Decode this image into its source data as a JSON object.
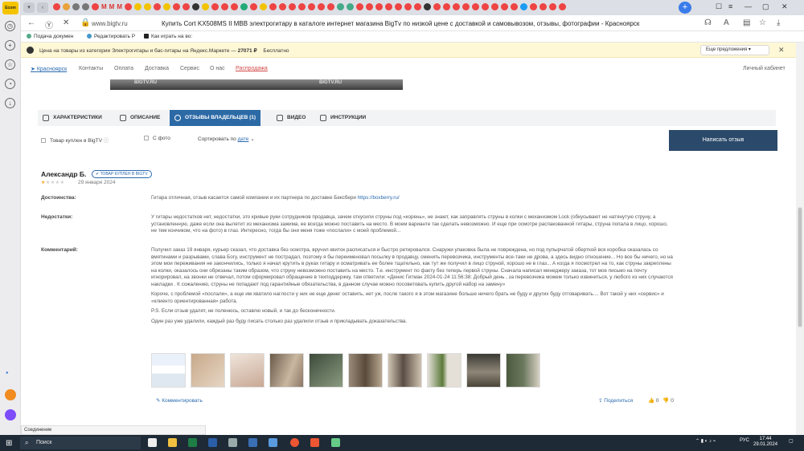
{
  "browser": {
    "sidebar_logo": "Ecom",
    "tab_title": "Купить Cort KX508MS II MBB электрогитару в каталоге интернет магазина BigTv по низкой цене с доставкой и самовывозом, отзывы, фотографии - Красноярск",
    "url": "www.bigtv.ru",
    "favicon_letters": [
      "M",
      "M",
      "M"
    ],
    "new_tab_icon": "plus-icon",
    "bookmarks": [
      "Подача докумен",
      "Редактировать Р",
      "Как играть на во:"
    ]
  },
  "infobar": {
    "text_prefix": "Цена на товары из категории Электрогитары и бас-гитары на Яндекс.Маркете —",
    "price": "27071 ₽",
    "text_suffix": "Бесплатно",
    "more_label": "Еще предложения ▾",
    "close_label": "✕"
  },
  "site_nav": {
    "city": "Красноярск",
    "items": [
      "Контакты",
      "Оплата",
      "Доставка",
      "Сервис",
      "О нас"
    ],
    "sale": "Распродажа",
    "account": "Личный кабинет",
    "banner_text": "BIGTV.RU"
  },
  "tabs": [
    {
      "label": "ХАРАКТЕРИСТИКИ",
      "icon": "info-icon"
    },
    {
      "label": "ОПИСАНИЕ",
      "icon": "document-icon"
    },
    {
      "label": "ОТЗЫВЫ ВЛАДЕЛЬЦЕВ (1)",
      "icon": "chat-icon"
    },
    {
      "label": "ВИДЕО",
      "icon": "play-icon"
    },
    {
      "label": "ИНСТРУКЦИИ",
      "icon": "book-icon"
    }
  ],
  "filters": {
    "bought": "Товар куплен в BigTV",
    "with_photo": "С фото",
    "sort_label": "Сортировать по",
    "sort_value": "дате",
    "write_review": "Написать отзыв"
  },
  "review": {
    "author": "Александр Б.",
    "badge": "ТОВАР КУПЛЕН В BIGTV",
    "rating": 1,
    "rating_max": 5,
    "date": "29 января 2024",
    "pros_label": "Достоинства:",
    "pros": "Гитара отличная, отзыв касается самой компании и их партнера по доставке Бексбери",
    "pros_link": "https://boxberry.ru/",
    "cons_label": "Недостатки:",
    "cons": "У гитары недостатков нет, недостатки, это кривые руки сотрудников продавца, зачем откусили струны под «корень», не знают, как заправлять струны в колки с механизмом Lock (обкусывают не натянутую струну, а установленную, даже если она вылетит из механизма зажима, ее всегда можно поставить на место. В моем варианте так сделать невозможно. И еще при осмотре распакованной гитары, струна попала в лицо, хорошо, не тем кончиком, что на фото) в глаз. Интересно, тогда бы они меня тоже «послали» с моей проблемой...",
    "comment_label": "Комментарий:",
    "comment_p1": "Получил заказ 19 января, курьер сказал, что доставка без осмотра, вручил квиток расписаться и быстро ретировался. Снаружи упаковка была не повреждена, но под пупырчатой оберткой вся коробка оказалась со вмятинами и разрывами, слава Богу, инструмент не пострадал, поэтому я бы переименовал посылку в продавцу, сменить перевозчика, инструменты все-таки не дрова, а здесь видно отношение... Но все бы ничего, но на этом мои переживания не закончились, только я начал крутить в руках гитару и осматривать ее более тщательно, как тут же получил в лицо струной, хорошо не в глаз... А когда я посмотрел на то, как струны закреплены на колки, оказалось они обрезаны таким образом, что струну невозможно поставить на место. Т.е. инструмент по факту без теперь первой струны. Сначала написал менеджеру заказа, тот мое письмо на почту игнорировал, на звонки не отвечал, потом сформировал обращение в техподдержку, там ответили: «Денис Гитман 2024-01-24 11:56:38: Добрый день , за перевозчика можем только извиниться, у любого из них случаются накладки . К сожалению, струны не попадают под гарантийные обязательства, в данном случае можно посоветовать купить другой набор на замену»",
    "comment_p2": "Короче, с проблемой «послали», а еще им хватило наглости у них не еще денег оставить, нет уж, после такого я в этом магазине больше ничего брать не буду и других буду отговаривать.... Вот такой у них «сервис» и «клиенто ориентированная» работа.",
    "comment_p3": "P.S. Если отзыв удалят, не поленюсь, оставлю новый, и так до бесконечности.",
    "comment_p4": "Один раз уже удалили, каждый раз буду писать столько раз удалили отзыв и прикладывать доказательства.",
    "photo_count": 10,
    "comment_link": "Комментировать",
    "share": "Поделиться",
    "likes": "0",
    "dislikes": "0"
  },
  "status_bar": "Соединение",
  "taskbar": {
    "search": "Поиск",
    "lang": "РУС",
    "time": "17:44",
    "date": "29.01.2024"
  },
  "colors": {
    "accent": "#2c6aa6",
    "write_button": "#2b4a6b",
    "sale": "#d24a4a",
    "infobar": "#fff8d6",
    "taskbar": "#1e2a36"
  }
}
